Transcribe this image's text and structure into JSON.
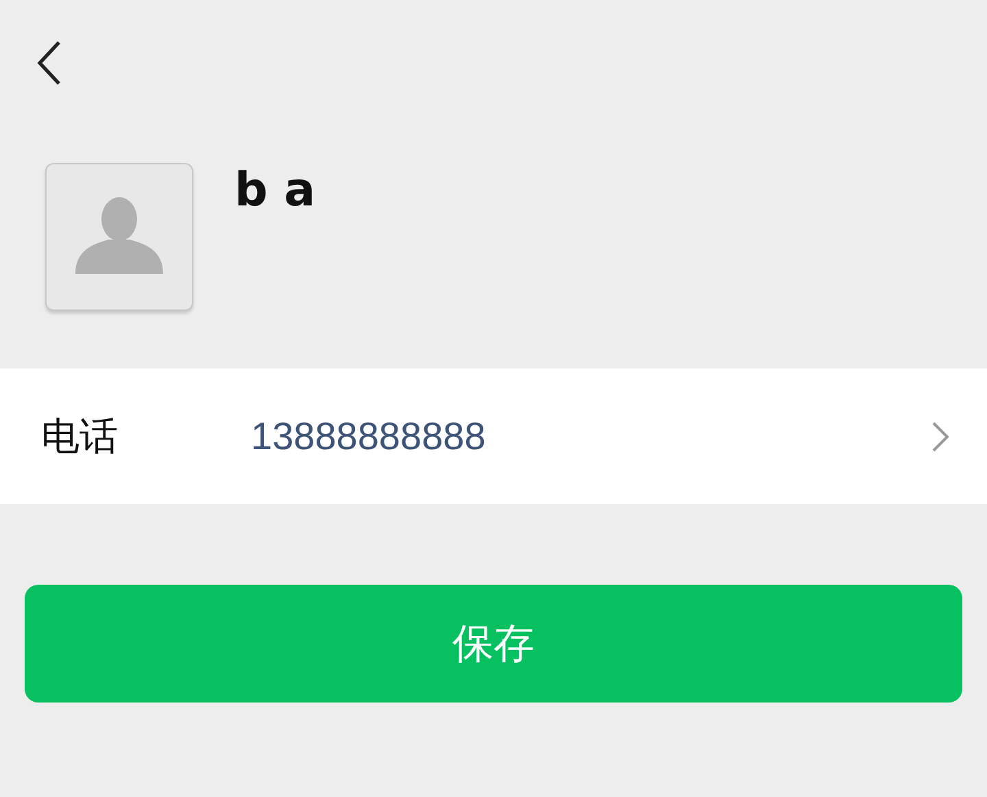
{
  "profile": {
    "name": "b a"
  },
  "fields": [
    {
      "label": "电话",
      "value": "13888888888"
    }
  ],
  "save_button": {
    "label": "保存"
  }
}
